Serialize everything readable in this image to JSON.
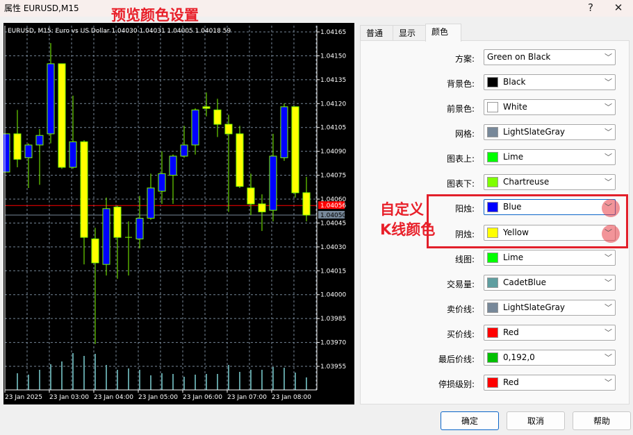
{
  "window": {
    "title": "属性 EURUSD,M15",
    "help_glyph": "?",
    "close_glyph": "✕"
  },
  "annotations": {
    "preview": "预览颜色设置",
    "custom_line1": "自定义",
    "custom_line2": "K线颜色"
  },
  "tabs": [
    {
      "label": "普通"
    },
    {
      "label": "显示"
    },
    {
      "label": "颜色",
      "active": true
    }
  ],
  "scheme": {
    "label": "方案:",
    "value": "Green on Black"
  },
  "color_rows": [
    {
      "label": "背景色:",
      "value": "Black",
      "color": "#000000"
    },
    {
      "label": "前景色:",
      "value": "White",
      "color": "#ffffff"
    },
    {
      "label": "网格:",
      "value": "LightSlateGray",
      "color": "#778899"
    },
    {
      "label": "图表上:",
      "value": "Lime",
      "color": "#00ff00"
    },
    {
      "label": "图表下:",
      "value": "Chartreuse",
      "color": "#7fff00"
    },
    {
      "label": "阳烛:",
      "value": "Blue",
      "color": "#0000ff",
      "highlighted": true
    },
    {
      "label": "阴烛:",
      "value": "Yellow",
      "color": "#ffff00",
      "highlighted": true
    },
    {
      "label": "线图:",
      "value": "Lime",
      "color": "#00ff00"
    },
    {
      "label": "交易量:",
      "value": "CadetBlue",
      "color": "#5f9ea0"
    },
    {
      "label": "卖价线:",
      "value": "LightSlateGray",
      "color": "#778899"
    },
    {
      "label": "买价线:",
      "value": "Red",
      "color": "#ff0000"
    },
    {
      "label": "最后价线:",
      "value": "0,192,0",
      "color": "#00c000"
    },
    {
      "label": "停损级别:",
      "value": "Red",
      "color": "#ff0000"
    }
  ],
  "buttons": {
    "ok": "确定",
    "cancel": "取消",
    "help": "帮助"
  },
  "chart_data": {
    "type": "candlestick",
    "header": "EURUSD, M15:  Euro vs US Dollar  1.04030 1.04031 1.04005 1.04018  59",
    "ylim": [
      1.0394,
      1.0417
    ],
    "y_ticks": [
      "1.04165",
      "1.04150",
      "1.04135",
      "1.04120",
      "1.04105",
      "1.04090",
      "1.04075",
      "1.04060",
      "1.04045",
      "1.04030",
      "1.04015",
      "1.04000",
      "1.03985",
      "1.03970",
      "1.03955"
    ],
    "x_tick_labels": [
      "23 Jan 2025",
      "23 Jan 03:00",
      "23 Jan 04:00",
      "23 Jan 05:00",
      "23 Jan 06:00",
      "23 Jan 07:00",
      "23 Jan 08:00"
    ],
    "timeframe": "M15",
    "first_bar_time": "23 Jan 2025 02:00",
    "grid": true,
    "colors": {
      "background": "#000000",
      "foreground": "#ffffff",
      "grid": "#778899",
      "wick": "#7fff00",
      "bull": "#0000ff",
      "bear": "#ffff00",
      "volume": "#5f9ea0",
      "ask_line": "#ff0000",
      "bid_line": "#778899"
    },
    "ask_price": "1.04056",
    "bid_price": "1.04050",
    "candles": [
      {
        "o": 1.04077,
        "h": 1.04101,
        "l": 1.04077,
        "c": 1.04101
      },
      {
        "o": 1.04101,
        "h": 1.04116,
        "l": 1.0408,
        "c": 1.04085
      },
      {
        "o": 1.04086,
        "h": 1.04095,
        "l": 1.04067,
        "c": 1.04094
      },
      {
        "o": 1.04094,
        "h": 1.04104,
        "l": 1.04069,
        "c": 1.041
      },
      {
        "o": 1.04101,
        "h": 1.04158,
        "l": 1.04095,
        "c": 1.04145
      },
      {
        "o": 1.04145,
        "h": 1.04145,
        "l": 1.04079,
        "c": 1.0408
      },
      {
        "o": 1.0408,
        "h": 1.04125,
        "l": 1.04079,
        "c": 1.04096
      },
      {
        "o": 1.04096,
        "h": 1.04097,
        "l": 1.04019,
        "c": 1.04036
      },
      {
        "o": 1.04035,
        "h": 1.04042,
        "l": 1.03969,
        "c": 1.0402
      },
      {
        "o": 1.04019,
        "h": 1.04061,
        "l": 1.04012,
        "c": 1.04054
      },
      {
        "o": 1.04055,
        "h": 1.04056,
        "l": 1.0401,
        "c": 1.04036
      },
      {
        "o": 1.04036,
        "h": 1.04046,
        "l": 1.04012,
        "c": 1.04036
      },
      {
        "o": 1.04035,
        "h": 1.04062,
        "l": 1.04029,
        "c": 1.04048
      },
      {
        "o": 1.04048,
        "h": 1.04076,
        "l": 1.04047,
        "c": 1.04067
      },
      {
        "o": 1.04065,
        "h": 1.0409,
        "l": 1.04057,
        "c": 1.04076
      },
      {
        "o": 1.04075,
        "h": 1.04088,
        "l": 1.04057,
        "c": 1.04087
      },
      {
        "o": 1.04087,
        "h": 1.04106,
        "l": 1.04086,
        "c": 1.04094
      },
      {
        "o": 1.04094,
        "h": 1.04117,
        "l": 1.04088,
        "c": 1.04116
      },
      {
        "o": 1.04118,
        "h": 1.04127,
        "l": 1.04112,
        "c": 1.04117
      },
      {
        "o": 1.04116,
        "h": 1.04123,
        "l": 1.04099,
        "c": 1.04107
      },
      {
        "o": 1.04107,
        "h": 1.04113,
        "l": 1.04052,
        "c": 1.04101
      },
      {
        "o": 1.04101,
        "h": 1.04106,
        "l": 1.04067,
        "c": 1.04068
      },
      {
        "o": 1.04067,
        "h": 1.04076,
        "l": 1.0405,
        "c": 1.04057
      },
      {
        "o": 1.04057,
        "h": 1.04063,
        "l": 1.0404,
        "c": 1.04052
      },
      {
        "o": 1.04053,
        "h": 1.04101,
        "l": 1.04046,
        "c": 1.04087
      },
      {
        "o": 1.04086,
        "h": 1.0412,
        "l": 1.04084,
        "c": 1.04118
      },
      {
        "o": 1.04118,
        "h": 1.04118,
        "l": 1.04061,
        "c": 1.04064
      },
      {
        "o": 1.04064,
        "h": 1.04074,
        "l": 1.04046,
        "c": 1.0405
      }
    ],
    "volumes_relative": [
      0,
      24,
      22,
      29,
      37,
      41,
      53,
      49,
      52,
      36,
      29,
      31,
      29,
      21,
      24,
      23,
      19,
      22,
      23,
      23,
      36,
      26,
      29,
      29,
      33,
      32,
      25,
      18
    ]
  }
}
